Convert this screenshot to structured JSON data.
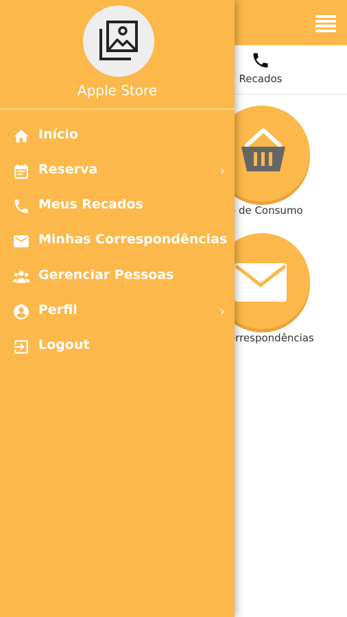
{
  "colors": {
    "accent": "#fcb84a",
    "drawer_text": "#ffffff",
    "tile_icon": "#666666"
  },
  "header": {
    "menu_icon": "hamburger-icon"
  },
  "quickbar": {
    "recados_label": "Recados",
    "recados_icon": "phone-icon"
  },
  "tiles": [
    {
      "label": "o de Consumo",
      "icon": "basket-icon"
    },
    {
      "label": "orrespondências",
      "icon": "envelope-icon"
    }
  ],
  "drawer": {
    "store_name": "Apple Store",
    "avatar_icon": "image-gallery-icon",
    "items": [
      {
        "label": "Início",
        "icon": "home-icon",
        "has_submenu": false
      },
      {
        "label": "Reserva",
        "icon": "calendar-icon",
        "has_submenu": true
      },
      {
        "label": "Meus Recados",
        "icon": "phone-icon",
        "has_submenu": false
      },
      {
        "label": "Minhas Correspondências",
        "icon": "mail-icon",
        "has_submenu": false
      },
      {
        "label": "Gerenciar Pessoas",
        "icon": "people-icon",
        "has_submenu": false
      },
      {
        "label": "Perfil",
        "icon": "account-icon",
        "has_submenu": true
      },
      {
        "label": "Logout",
        "icon": "logout-icon",
        "has_submenu": false
      }
    ],
    "chevron": "›"
  }
}
